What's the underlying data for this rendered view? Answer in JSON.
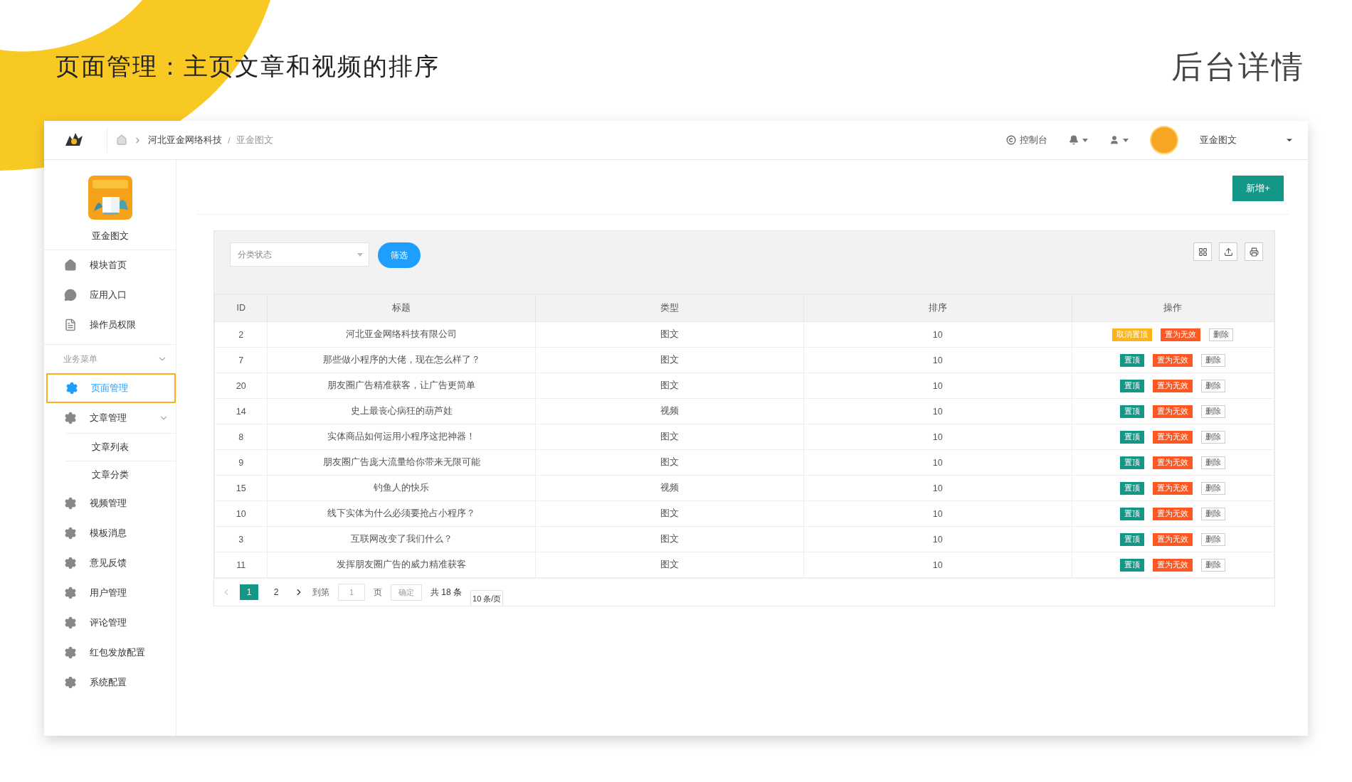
{
  "slide": {
    "heading": "页面管理：主页文章和视频的排序",
    "caption": "后台详情"
  },
  "header": {
    "separator": "/",
    "breadcrumb": [
      {
        "label": "河北亚金网络科技",
        "current": false
      },
      {
        "label": "亚金图文",
        "current": true
      }
    ],
    "console": "控制台",
    "user_name": "亚金图文"
  },
  "sidebar": {
    "app_name": "亚金图文",
    "top_items": [
      {
        "label": "模块首页"
      },
      {
        "label": "应用入口"
      },
      {
        "label": "操作员权限"
      }
    ],
    "section": {
      "label": "业务菜单",
      "expanded": true
    },
    "items": [
      {
        "label": "页面管理",
        "selected": true
      },
      {
        "label": "文章管理",
        "selected": false,
        "expanded": true,
        "children": [
          {
            "label": "文章列表"
          },
          {
            "label": "文章分类"
          }
        ]
      },
      {
        "label": "视频管理",
        "selected": false
      },
      {
        "label": "模板消息",
        "selected": false
      },
      {
        "label": "意见反馈",
        "selected": false
      },
      {
        "label": "用户管理",
        "selected": false
      },
      {
        "label": "评论管理",
        "selected": false
      },
      {
        "label": "红包发放配置",
        "selected": false
      },
      {
        "label": "系统配置",
        "selected": false
      }
    ]
  },
  "toolbar": {
    "add_button": "新增+"
  },
  "filter": {
    "placeholder": "分类状态",
    "button": "筛选"
  },
  "table": {
    "columns": [
      "ID",
      "标题",
      "类型",
      "排序",
      "操作"
    ],
    "rows": [
      {
        "id": "2",
        "title": "河北亚金网络科技有限公司",
        "type": "图文",
        "order": "10",
        "actions": [
          {
            "kind": "unpin",
            "label": "取消置顶"
          },
          {
            "kind": "invalidate",
            "label": "置为无效"
          },
          {
            "kind": "delete",
            "label": "删除"
          }
        ]
      },
      {
        "id": "7",
        "title": "那些做小程序的大佬，现在怎么样了？",
        "type": "图文",
        "order": "10",
        "actions": [
          {
            "kind": "pin",
            "label": "置顶"
          },
          {
            "kind": "invalidate",
            "label": "置为无效"
          },
          {
            "kind": "delete",
            "label": "删除"
          }
        ]
      },
      {
        "id": "20",
        "title": "朋友圈广告精准获客，让广告更简单",
        "type": "图文",
        "order": "10",
        "actions": [
          {
            "kind": "pin",
            "label": "置顶"
          },
          {
            "kind": "invalidate",
            "label": "置为无效"
          },
          {
            "kind": "delete",
            "label": "删除"
          }
        ]
      },
      {
        "id": "14",
        "title": "史上最丧心病狂的葫芦娃",
        "type": "视频",
        "order": "10",
        "actions": [
          {
            "kind": "pin",
            "label": "置顶"
          },
          {
            "kind": "invalidate",
            "label": "置为无效"
          },
          {
            "kind": "delete",
            "label": "删除"
          }
        ]
      },
      {
        "id": "8",
        "title": "实体商品如何运用小程序这把神器！",
        "type": "图文",
        "order": "10",
        "actions": [
          {
            "kind": "pin",
            "label": "置顶"
          },
          {
            "kind": "invalidate",
            "label": "置为无效"
          },
          {
            "kind": "delete",
            "label": "删除"
          }
        ]
      },
      {
        "id": "9",
        "title": "朋友圈广告庞大流量给你带来无限可能",
        "type": "图文",
        "order": "10",
        "actions": [
          {
            "kind": "pin",
            "label": "置顶"
          },
          {
            "kind": "invalidate",
            "label": "置为无效"
          },
          {
            "kind": "delete",
            "label": "删除"
          }
        ]
      },
      {
        "id": "15",
        "title": "钓鱼人的快乐",
        "type": "视频",
        "order": "10",
        "actions": [
          {
            "kind": "pin",
            "label": "置顶"
          },
          {
            "kind": "invalidate",
            "label": "置为无效"
          },
          {
            "kind": "delete",
            "label": "删除"
          }
        ]
      },
      {
        "id": "10",
        "title": "线下实体为什么必须要抢占小程序？",
        "type": "图文",
        "order": "10",
        "actions": [
          {
            "kind": "pin",
            "label": "置顶"
          },
          {
            "kind": "invalidate",
            "label": "置为无效"
          },
          {
            "kind": "delete",
            "label": "删除"
          }
        ]
      },
      {
        "id": "3",
        "title": "互联网改变了我们什么？",
        "type": "图文",
        "order": "10",
        "actions": [
          {
            "kind": "pin",
            "label": "置顶"
          },
          {
            "kind": "invalidate",
            "label": "置为无效"
          },
          {
            "kind": "delete",
            "label": "删除"
          }
        ]
      },
      {
        "id": "11",
        "title": "发挥朋友圈广告的威力精准获客",
        "type": "图文",
        "order": "10",
        "actions": [
          {
            "kind": "pin",
            "label": "置顶"
          },
          {
            "kind": "invalidate",
            "label": "置为无效"
          },
          {
            "kind": "delete",
            "label": "删除"
          }
        ]
      }
    ]
  },
  "pagination": {
    "pages": [
      {
        "label": "1",
        "selected": true
      },
      {
        "label": "2",
        "selected": false
      }
    ],
    "goto_label": "到第",
    "goto_value": "1",
    "page_unit": "页",
    "confirm": "确定",
    "total": "共 18 条",
    "page_size": "10 条/页"
  }
}
